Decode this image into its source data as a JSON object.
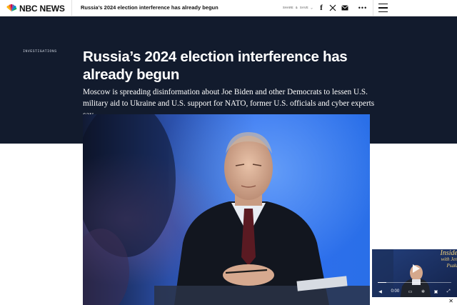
{
  "nav": {
    "brand": "NBC NEWS",
    "article_headline": "Russia’s 2024 election interference has already begun",
    "share_save": "SHARE & SAVE",
    "share_chevron": "⌄",
    "facebook_label": "f",
    "more_label": "•••"
  },
  "article": {
    "eyebrow": "INVESTIGATIONS",
    "title": "Russia’s 2024 election interference has already begun",
    "dek": "Moscow is spreading disinformation about Joe Biden and other Democrats to lessen U.S. military aid to Ukraine and U.S. support for NATO, former U.S. officials and cyber experts say."
  },
  "video": {
    "show_title_line1": "Inside",
    "show_title_line2": "with Jen Psaki",
    "time": "0:00",
    "progress": 0.12,
    "close_label": "✕"
  },
  "colors": {
    "hero_bg": "#121b2d",
    "text_light": "#ffffff",
    "nav_text": "#111111"
  }
}
